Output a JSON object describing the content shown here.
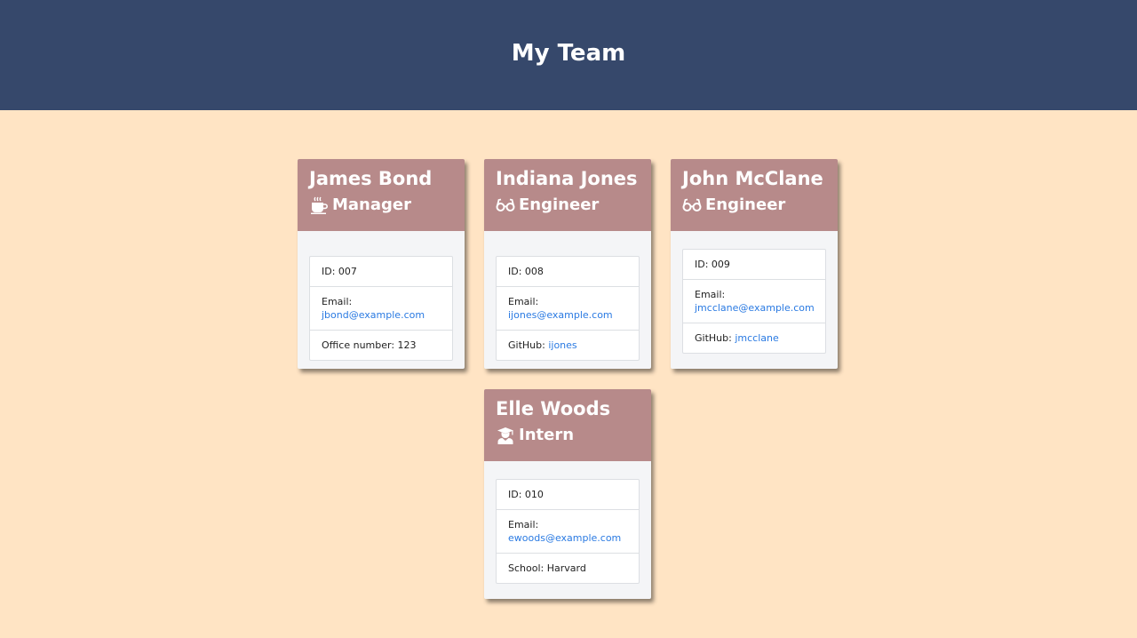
{
  "header": {
    "title": "My Team"
  },
  "team": [
    {
      "name": "James Bond",
      "role": "Manager",
      "role_icon": "coffee-icon",
      "id_label": "ID: ",
      "id": "007",
      "email_label": "Email: ",
      "email": "jbond@example.com",
      "extra_label": "Office number: ",
      "extra": "123"
    },
    {
      "name": "Indiana Jones",
      "role": "Engineer",
      "role_icon": "glasses-icon",
      "id_label": "ID: ",
      "id": "008",
      "email_label": "Email: ",
      "email": "ijones@example.com",
      "extra_label": "GitHub: ",
      "extra": "ijones"
    },
    {
      "name": "John McClane",
      "role": "Engineer",
      "role_icon": "glasses-icon",
      "id_label": "ID: ",
      "id": "009",
      "email_label": "Email: ",
      "email": "jmcclane@example.com",
      "extra_label": "GitHub: ",
      "extra": "jmcclane"
    },
    {
      "name": "Elle Woods",
      "role": "Intern",
      "role_icon": "graduate-icon",
      "id_label": "ID: ",
      "id": "010",
      "email_label": "Email: ",
      "email": "ewoods@example.com",
      "extra_label": "School: ",
      "extra": "Harvard"
    }
  ],
  "colors": {
    "header_bg": "#36486b",
    "page_bg": "#ffe4c4",
    "card_head_bg": "#b78a8a",
    "link": "#2a7ae2"
  }
}
